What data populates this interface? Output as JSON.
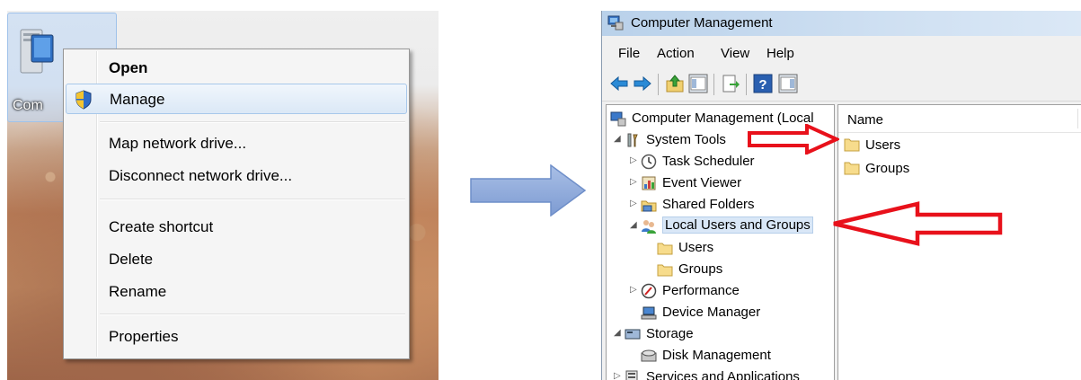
{
  "desktop": {
    "computer_label": "Com"
  },
  "context_menu": {
    "items": [
      {
        "label": "Open"
      },
      {
        "label": "Manage"
      },
      {
        "label": "Map network drive..."
      },
      {
        "label": "Disconnect network drive..."
      },
      {
        "label": "Create shortcut"
      },
      {
        "label": "Delete"
      },
      {
        "label": "Rename"
      },
      {
        "label": "Properties"
      }
    ]
  },
  "window": {
    "title": "Computer Management",
    "menu": [
      "File",
      "Action",
      "View",
      "Help"
    ]
  },
  "tree": {
    "items": [
      {
        "label": "Computer Management (Local"
      },
      {
        "label": "System Tools"
      },
      {
        "label": "Task Scheduler"
      },
      {
        "label": "Event Viewer"
      },
      {
        "label": "Shared Folders"
      },
      {
        "label": "Local Users and Groups"
      },
      {
        "label": "Users"
      },
      {
        "label": "Groups"
      },
      {
        "label": "Performance"
      },
      {
        "label": "Device Manager"
      },
      {
        "label": "Storage"
      },
      {
        "label": "Disk Management"
      },
      {
        "label": "Services and Applications"
      }
    ]
  },
  "list": {
    "header_name": "Name",
    "items": [
      {
        "label": "Users"
      },
      {
        "label": "Groups"
      }
    ]
  },
  "colors": {
    "annotation_red": "#e8111b",
    "arrow_blue": "#8ea9db"
  }
}
